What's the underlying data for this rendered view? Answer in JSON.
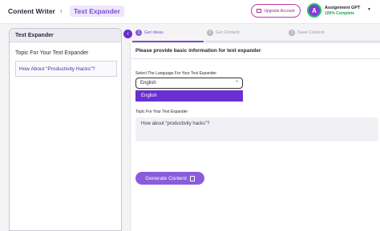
{
  "header": {
    "breadcrumb_root": "Content Writer",
    "breadcrumb_sep": "›",
    "breadcrumb_current": "Text Expander",
    "upgrade_label": "Upgrade Account",
    "avatar_initial": "A",
    "account_name": "Assignment GPT",
    "account_status": "100% Complete",
    "account_caret": "▼"
  },
  "left_panel": {
    "title": "Text Expander",
    "field_label": "Topic For Your Text Expander",
    "field_value": "How About “Productivity Hacks”?"
  },
  "steps": [
    {
      "num": "1",
      "label": "Get Ideas",
      "active": true
    },
    {
      "num": "2",
      "label": "Get Content",
      "active": false
    },
    {
      "num": "3",
      "label": "Save Content",
      "active": false
    }
  ],
  "collapse_icon": "‹",
  "form": {
    "title": "Please provide basic information for text expander",
    "language_label": "Select The Language For Your Text Expander",
    "language_value": "English",
    "language_chevron": "⌃",
    "dropdown_options": [
      "English"
    ],
    "topic_label": "Topic For Your Text Expander",
    "topic_value": "How about “productivity hacks”?",
    "generate_label": "Generate Content"
  },
  "colors": {
    "accent": "#7a4fd0",
    "accent_dark": "#6a2fd0",
    "success": "#21a355",
    "upgrade": "#c23aa6"
  }
}
